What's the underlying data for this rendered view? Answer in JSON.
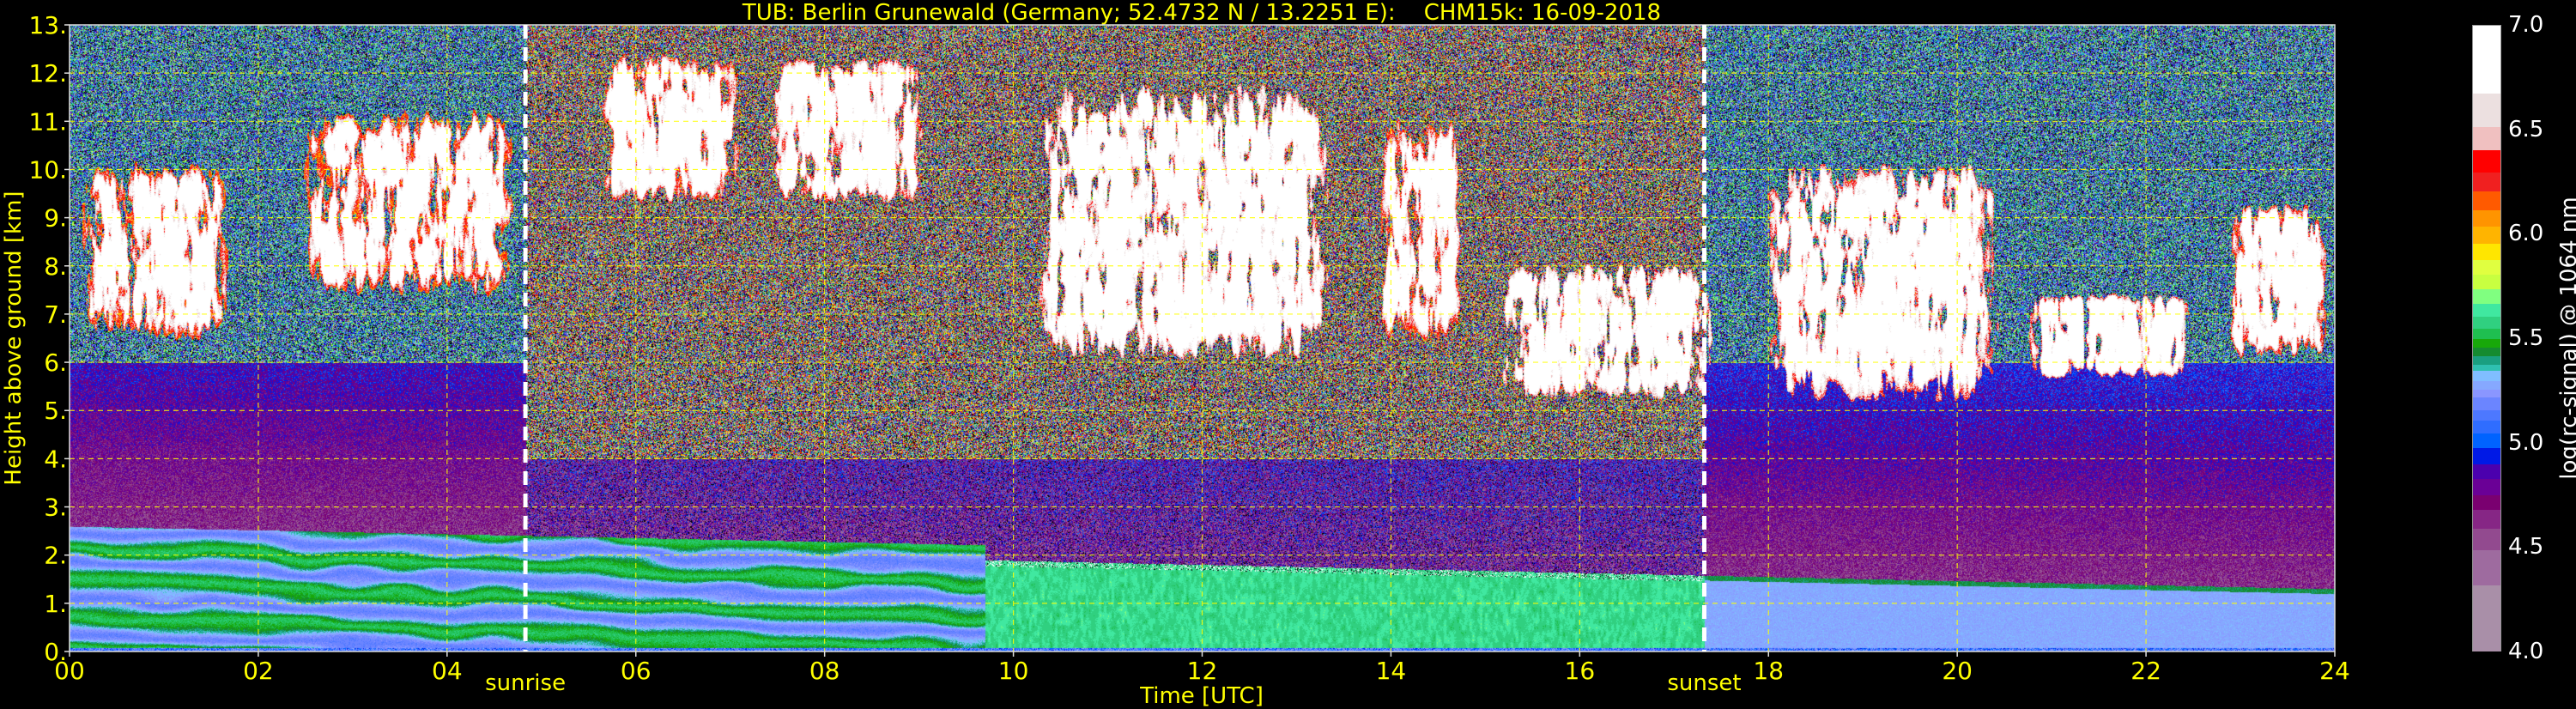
{
  "title": "TUB: Berlin Grunewald (Germany; 52.4732 N / 13.2251 E):    CHM15k: 16-09-2018",
  "chart_data": {
    "type": "heatmap",
    "title": "TUB: Berlin Grunewald (Germany; 52.4732 N / 13.2251 E):    CHM15k: 16-09-2018",
    "xlabel": "Time [UTC]",
    "ylabel": "Height above ground [km]",
    "xlim": [
      0,
      24
    ],
    "ylim": [
      0,
      13
    ],
    "x_ticks": [
      "00",
      "02",
      "04",
      "06",
      "08",
      "10",
      "12",
      "14",
      "16",
      "18",
      "20",
      "22",
      "24"
    ],
    "y_ticks": [
      "0.",
      "1.",
      "2.",
      "3.",
      "4.",
      "5.",
      "6.",
      "7.",
      "8.",
      "9.",
      "10.",
      "11.",
      "12.",
      "13."
    ],
    "grid": true,
    "grid_color": "#ffff00",
    "annotations": [
      {
        "label": "sunrise",
        "time_h": 4.83
      },
      {
        "label": "sunset",
        "time_h": 17.32
      }
    ],
    "colorbar": {
      "label": "log(rc-signal) @ 1064 nm",
      "range": [
        4.0,
        7.0
      ],
      "ticks": [
        "4.0",
        "4.5",
        "5.0",
        "5.5",
        "6.0",
        "6.5",
        "7.0"
      ],
      "levels": [
        4.0,
        4.32,
        4.49,
        4.59,
        4.68,
        4.75,
        4.83,
        4.9,
        4.98,
        5.05,
        5.11,
        5.16,
        5.22,
        5.26,
        5.3,
        5.35,
        5.38,
        5.42,
        5.46,
        5.5,
        5.55,
        5.61,
        5.67,
        5.74,
        5.81,
        5.88,
        5.96,
        6.04,
        6.12,
        6.21,
        6.3,
        6.41,
        6.52,
        6.68,
        7.0
      ],
      "colors": [
        "#a98fa8",
        "#9e6b9f",
        "#924a8f",
        "#862685",
        "#7a0070",
        "#6a0096",
        "#4b00ae",
        "#0019e6",
        "#0063ff",
        "#2f6dff",
        "#4d78ff",
        "#6b85ff",
        "#8a96ff",
        "#86a8ff",
        "#80beff",
        "#2fc0b0",
        "#1a9f80",
        "#158b30",
        "#18a80a",
        "#1fbf50",
        "#30d080",
        "#40e8a0",
        "#80ff80",
        "#c8ff40",
        "#e0ff40",
        "#ffe600",
        "#ffb400",
        "#ff9400",
        "#ff5a00",
        "#f02020",
        "#ff0000",
        "#f0c0c0",
        "#ece0e0",
        "#ffffff"
      ]
    },
    "features": [
      {
        "t": [
          0.0,
          1.8
        ],
        "h": [
          6.1,
          10.5
        ],
        "level": 6.1
      },
      {
        "t": [
          2.3,
          4.9
        ],
        "h": [
          7.0,
          11.6
        ],
        "level": 6.1
      },
      {
        "t": [
          5.5,
          7.2
        ],
        "h": [
          9.0,
          12.7
        ],
        "level": 6.2
      },
      {
        "t": [
          7.3,
          9.2
        ],
        "h": [
          9.0,
          12.6
        ],
        "level": 6.3
      },
      {
        "t": [
          10.0,
          13.6
        ],
        "h": [
          5.5,
          12.3
        ],
        "level": 6.4
      },
      {
        "t": [
          13.8,
          14.8
        ],
        "h": [
          6.0,
          11.5
        ],
        "level": 6.2
      },
      {
        "t": [
          15.0,
          17.6
        ],
        "h": [
          5.0,
          8.3
        ],
        "level": 6.4
      },
      {
        "t": [
          17.8,
          20.6
        ],
        "h": [
          4.7,
          10.6
        ],
        "level": 6.3
      },
      {
        "t": [
          20.6,
          22.6
        ],
        "h": [
          5.5,
          7.6
        ],
        "level": 6.3
      },
      {
        "t": [
          22.8,
          24.0
        ],
        "h": [
          5.8,
          9.6
        ],
        "level": 6.2
      }
    ]
  }
}
